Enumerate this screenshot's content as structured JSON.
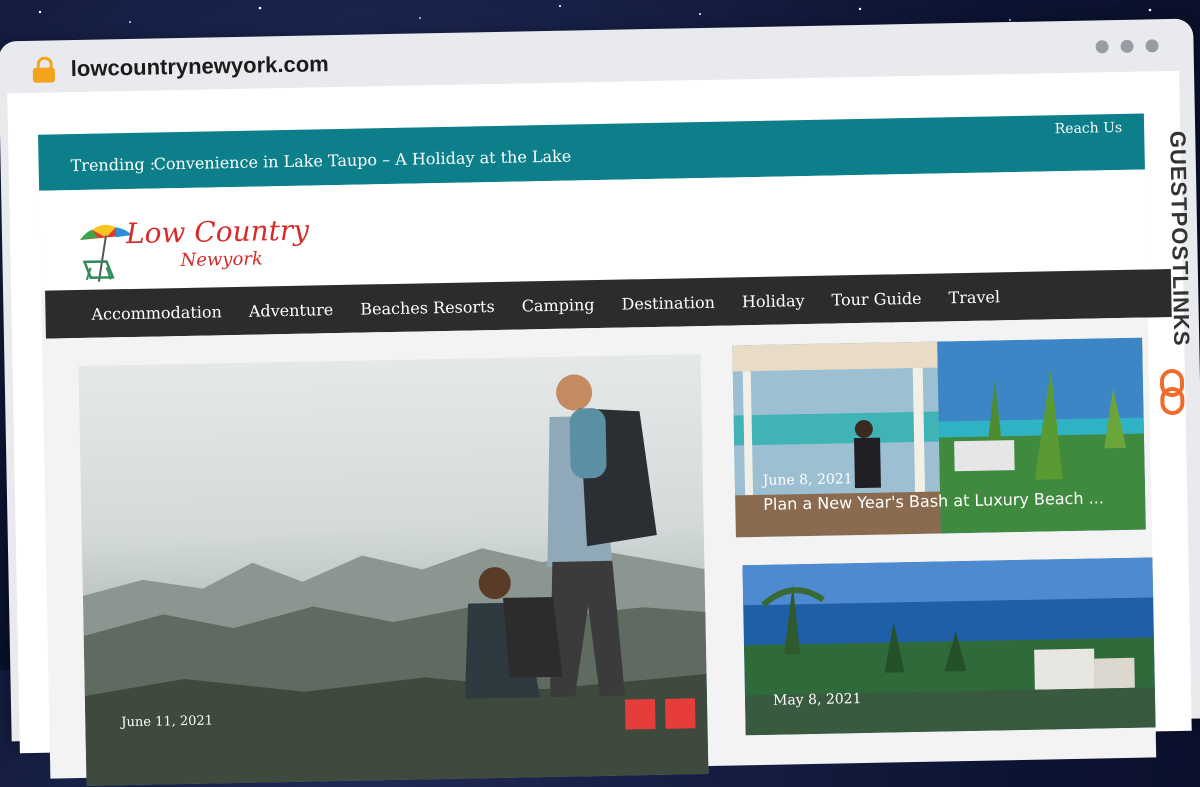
{
  "browser": {
    "url": "lowcountrynewyork.com"
  },
  "badge": {
    "text": "GUESTPOSTLINKS"
  },
  "topbar": {
    "trending_label": "Trending :",
    "trending_headline": "Convenience in Lake Taupo – A Holiday at the Lake",
    "reach_us": "Reach Us"
  },
  "logo": {
    "line1": "Low Country",
    "line2": "Newyork"
  },
  "nav": {
    "items": [
      "Accommodation",
      "Adventure",
      "Beaches Resorts",
      "Camping",
      "Destination",
      "Holiday",
      "Tour Guide",
      "Travel"
    ]
  },
  "hero": {
    "date": "June 11, 2021"
  },
  "posts": [
    {
      "date": "June 8, 2021",
      "title": "Plan a New Year's Bash at Luxury Beach ..."
    },
    {
      "date": "May 8, 2021"
    }
  ],
  "colors": {
    "accent_teal": "#0d7f8a",
    "nav_dark": "#2b2c2d",
    "logo_red": "#d62b2b",
    "arrow_red": "#e53c3c"
  }
}
